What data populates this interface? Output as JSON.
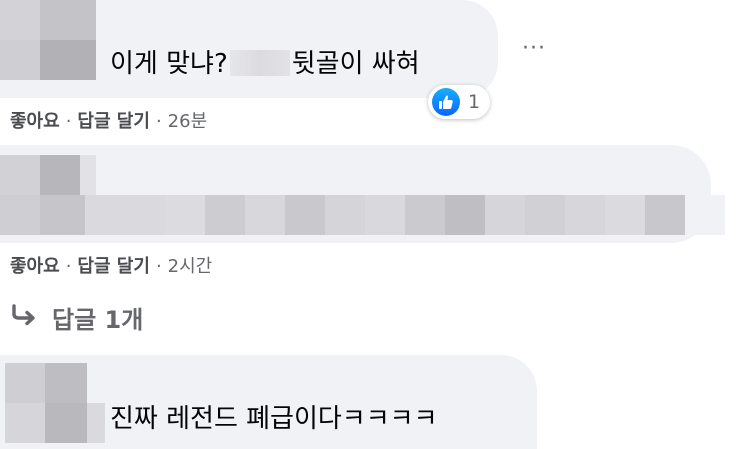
{
  "comments": [
    {
      "text_before": "이게 맞냐?",
      "text_after": "뒷골이 싸혀",
      "actions": {
        "like": "좋아요",
        "reply": "답글 달기",
        "separator": "·",
        "time": "26분"
      },
      "reaction": {
        "icon": "thumbs-up-icon",
        "count": "1"
      }
    },
    {
      "actions": {
        "like": "좋아요",
        "reply": "답글 달기",
        "separator": "·",
        "time": "2시간"
      },
      "replies_label": "답글 1개"
    },
    {
      "text": "진짜 레전드 폐급이다ㅋㅋㅋㅋ"
    }
  ],
  "more_options": "···",
  "colors": {
    "bubble": "#f0f2f5",
    "meta_text": "#65676b",
    "like_blue": "#0866ff"
  }
}
